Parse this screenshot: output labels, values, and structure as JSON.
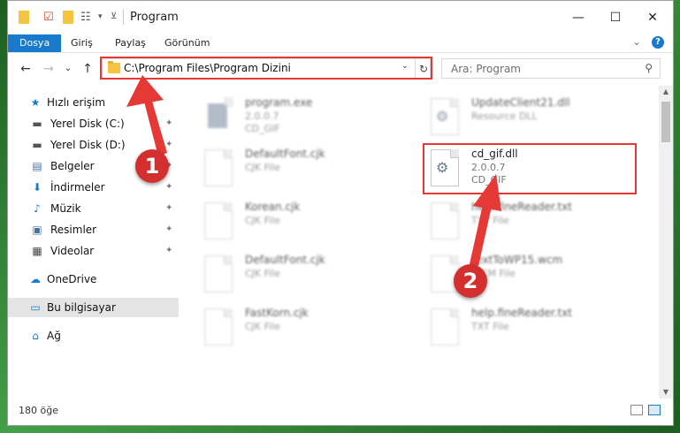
{
  "window": {
    "title": "Program",
    "controls": {
      "minimize": "—",
      "maximize": "☐",
      "close": "✕"
    }
  },
  "ribbon": {
    "tabs": [
      {
        "label": "Dosya",
        "active": true
      },
      {
        "label": "Giriş"
      },
      {
        "label": "Paylaş"
      },
      {
        "label": "Görünüm"
      }
    ],
    "expand_icon": "⌄",
    "help_icon": "?"
  },
  "address_bar": {
    "path": "C:\\Program Files\\Program Dizini",
    "dropdown_icon": "⌄",
    "refresh_icon": "↻"
  },
  "search": {
    "placeholder": "Ara: Program",
    "icon": "⚲"
  },
  "nav": {
    "back": "←",
    "forward": "→",
    "recent": "⌄",
    "up": "↑"
  },
  "sidebar": {
    "items": [
      {
        "label": "Hızlı erişim",
        "icon": "★",
        "pinned": false
      },
      {
        "label": "Yerel Disk (C:)",
        "icon": "▬",
        "pinned": true
      },
      {
        "label": "Yerel Disk (D:)",
        "icon": "▬",
        "pinned": true
      },
      {
        "label": "Belgeler",
        "icon": "▤",
        "pinned": true
      },
      {
        "label": "İndirmeler",
        "icon": "⬇",
        "pinned": true
      },
      {
        "label": "Müzik",
        "icon": "♪",
        "pinned": true
      },
      {
        "label": "Resimler",
        "icon": "▣",
        "pinned": true
      },
      {
        "label": "Videolar",
        "icon": "▦",
        "pinned": true
      },
      {
        "label": "OneDrive",
        "icon": "☁",
        "pinned": false
      },
      {
        "label": "Bu bilgisayar",
        "icon": "▭",
        "pinned": false,
        "selected": true
      },
      {
        "label": "Ağ",
        "icon": "⌂",
        "pinned": false
      }
    ],
    "pin_icon": "📌"
  },
  "files": {
    "left": [
      {
        "name": "program.exe",
        "meta1": "2.0.0.7",
        "meta2": "CD_GIF"
      },
      {
        "name": "DefaultFont.cjk",
        "meta1": "CJK File",
        "meta2": ""
      },
      {
        "name": "Korean.cjk",
        "meta1": "CJK File",
        "meta2": ""
      },
      {
        "name": "DefaultFont.cjk",
        "meta1": "CJK File",
        "meta2": ""
      },
      {
        "name": "FastKorn.cjk",
        "meta1": "CJK File",
        "meta2": ""
      }
    ],
    "right": [
      {
        "name": "UpdateClient21.dll",
        "meta1": "Resource DLL",
        "meta2": ""
      },
      {
        "name": "cd_gif.dll",
        "meta1": "2.0.0.7",
        "meta2": "CD_GIF",
        "highlighted": true
      },
      {
        "name": "help.fineReader.txt",
        "meta1": "TXT File",
        "meta2": ""
      },
      {
        "name": "TextToWP15.wcm",
        "meta1": "WCM File",
        "meta2": ""
      },
      {
        "name": "help.fineReader.txt",
        "meta1": "TXT File",
        "meta2": ""
      }
    ]
  },
  "status": {
    "count": "180 öğe"
  },
  "annotations": {
    "step1": "1",
    "step2": "2",
    "color": "#d32f2f"
  }
}
